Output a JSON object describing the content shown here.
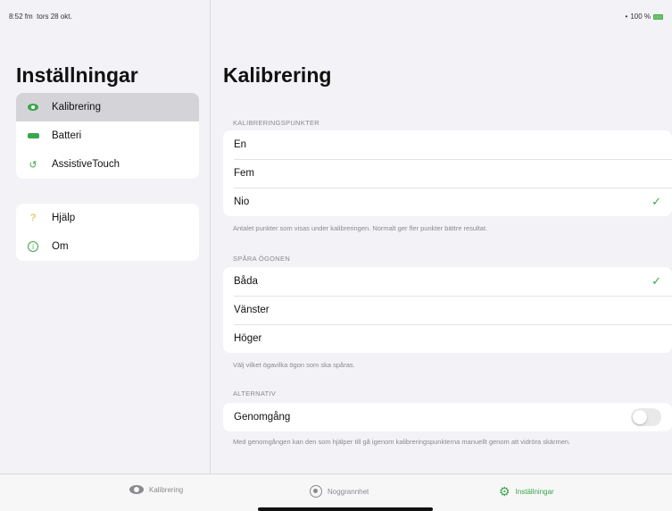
{
  "status_bar": {
    "time": "8:52 fm",
    "date": "tors 28 okt.",
    "battery": "100 %"
  },
  "sidebar": {
    "title": "Inställningar",
    "group1": [
      {
        "label": "Kalibrering",
        "icon": "eye-icon",
        "active": true
      },
      {
        "label": "Batteri",
        "icon": "battery-icon"
      },
      {
        "label": "AssistiveTouch",
        "icon": "assistive-touch-icon"
      }
    ],
    "group2": [
      {
        "label": "Hjälp",
        "icon": "question-icon"
      },
      {
        "label": "Om",
        "icon": "info-icon"
      }
    ]
  },
  "main": {
    "title": "Kalibrering",
    "calibration_points": {
      "header": "KALIBRERINGSPUNKTER",
      "options": [
        "En",
        "Fem",
        "Nio"
      ],
      "selected": "Nio",
      "footnote": "Antalet punkter som visas under kalibreringen. Normalt ger fler punkter bättre resultat."
    },
    "track_eyes": {
      "header": "SPÅRA ÖGONEN",
      "options": [
        "Båda",
        "Vänster",
        "Höger"
      ],
      "selected": "Båda",
      "footnote": "Välj vilket ögavilka ögon som ska spåras."
    },
    "alternative": {
      "header": "ALTERNATIV",
      "walkthrough_label": "Genomgång",
      "walkthrough_enabled": false,
      "footnote": "Med genomgången kan den som hjälper till gå igenom kalibreringspunkterna manuellt genom att vidröra skärmen."
    },
    "check_glyph": "✓"
  },
  "tabbar": {
    "tabs": [
      {
        "label": "Kalibrering",
        "icon": "eye-icon"
      },
      {
        "label": "Noggrannhet",
        "icon": "target-icon"
      },
      {
        "label": "Inställningar",
        "icon": "gear-icon",
        "active": true
      }
    ]
  },
  "colors": {
    "accent": "#3aa64a",
    "background": "#f2f2f7",
    "secondary_text": "#8a8a8e"
  }
}
